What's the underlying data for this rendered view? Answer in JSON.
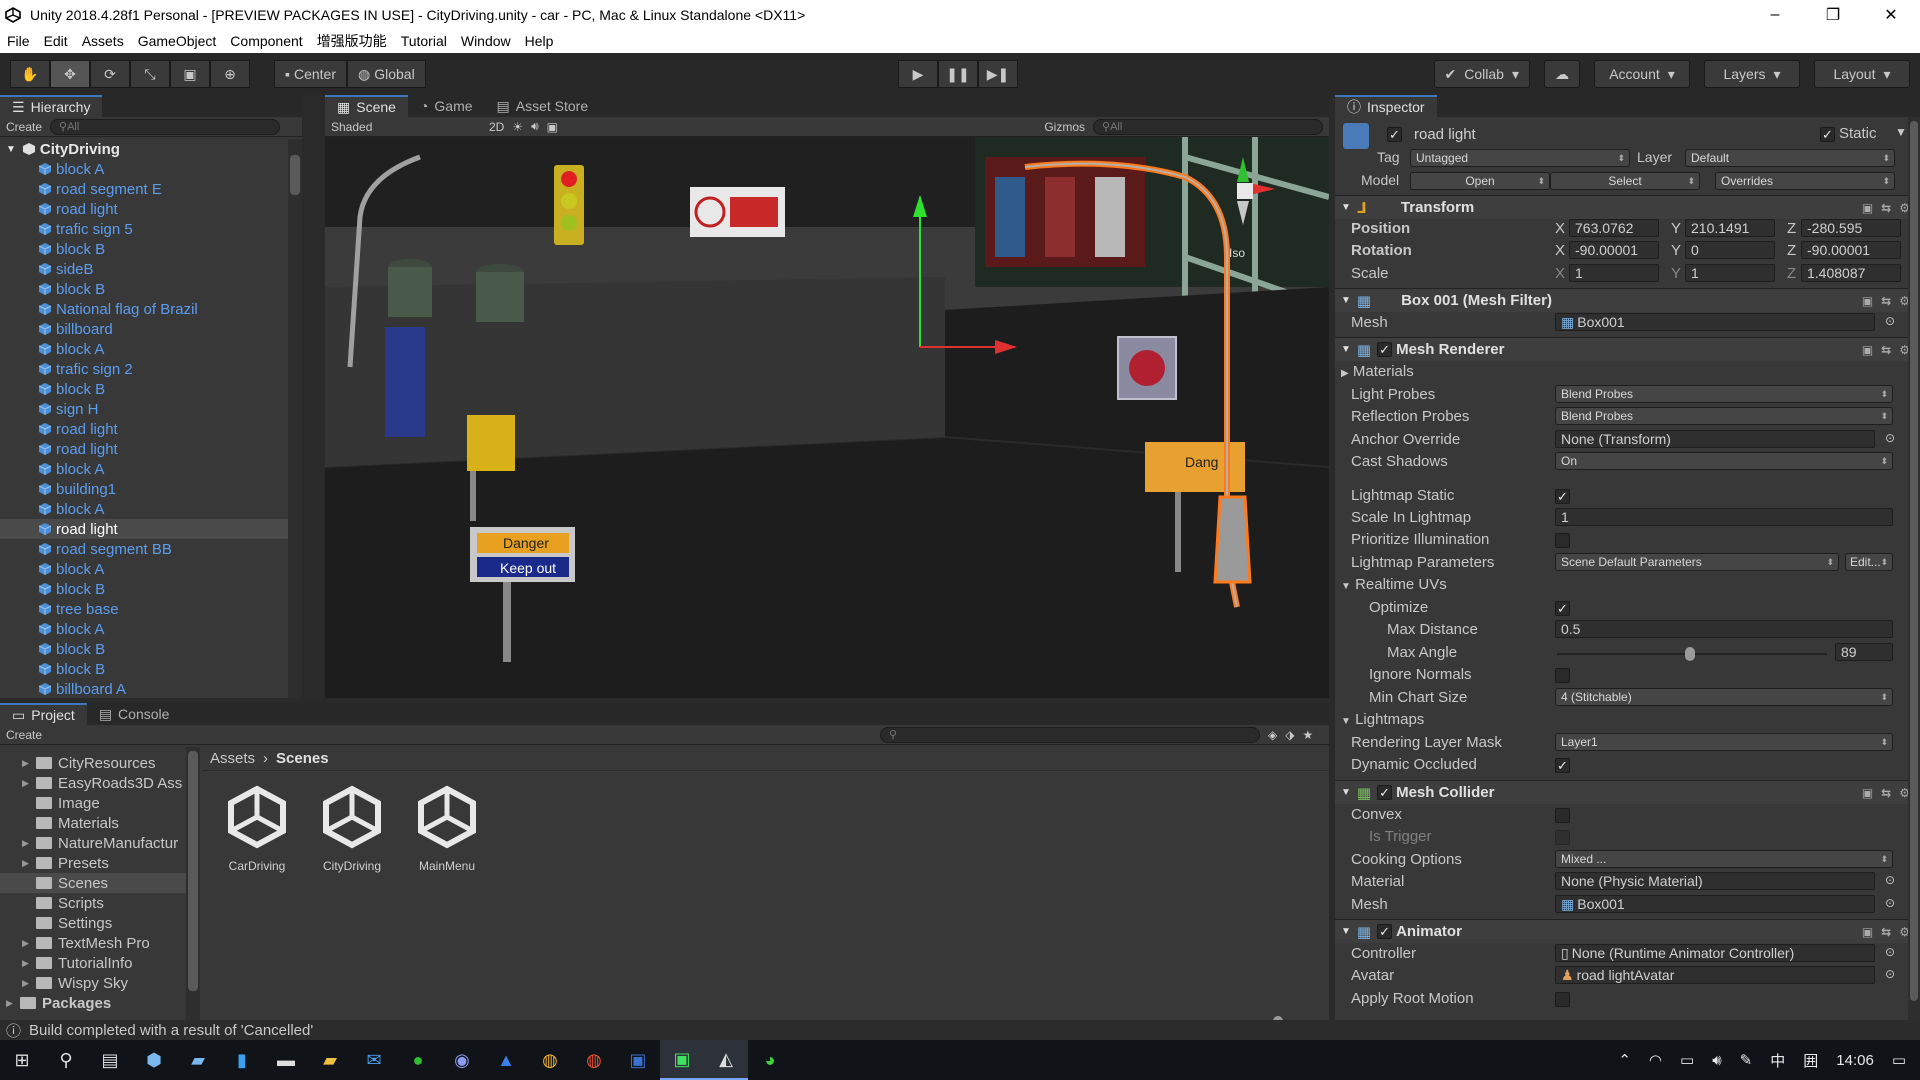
{
  "window": {
    "title": "Unity 2018.4.28f1 Personal - [PREVIEW PACKAGES IN USE] - CityDriving.unity - car - PC, Mac & Linux Standalone <DX11>",
    "controls": [
      "–",
      "❐",
      "✕"
    ]
  },
  "menu": [
    "File",
    "Edit",
    "Assets",
    "GameObject",
    "Component",
    "增强版功能",
    "Tutorial",
    "Window",
    "Help"
  ],
  "toolbar": {
    "pivot": "Center",
    "space": "Global",
    "collab": "Collab",
    "account": "Account",
    "layers": "Layers",
    "layout": "Layout"
  },
  "hierarchy": {
    "tab": "Hierarchy",
    "create": "Create",
    "search_placeholder": "All",
    "root": "CityDriving",
    "items": [
      "block A",
      "road segment E",
      "road light",
      "trafic sign 5",
      "block B",
      "sideB",
      "block B",
      "National flag of Brazil",
      "billboard",
      "block A",
      "trafic sign 2",
      "block B",
      "sign H",
      "road light",
      "road light",
      "block A",
      "building1",
      "block A",
      "road light",
      "road segment BB",
      "block A",
      "block B",
      "tree base",
      "block A",
      "block B",
      "block B",
      "billboard A"
    ],
    "selected_index": 18
  },
  "scene": {
    "tabs": [
      "Scene",
      "Game",
      "Asset Store"
    ],
    "shading": "Shaded",
    "mode_2d": "2D",
    "gizmos": "Gizmos",
    "search_placeholder": "All",
    "iso_label": "Iso",
    "sign_danger": "Danger",
    "sign_keep_out": "Keep out",
    "sign_danger2": "Dang"
  },
  "inspector": {
    "tab": "Inspector",
    "object_name": "road light",
    "static_label": "Static",
    "tag_label": "Tag",
    "tag_value": "Untagged",
    "layer_label": "Layer",
    "layer_value": "Default",
    "model_label": "Model",
    "model_open": "Open",
    "model_select": "Select",
    "model_overrides": "Overrides",
    "transform": {
      "title": "Transform",
      "position_label": "Position",
      "rotation_label": "Rotation",
      "scale_label": "Scale",
      "position": {
        "x": "763.0762",
        "y": "210.1491",
        "z": "-280.595"
      },
      "rotation": {
        "x": "-90.00001",
        "y": "0",
        "z": "-90.00001"
      },
      "scale": {
        "x": "1",
        "y": "1",
        "z": "1.408087"
      }
    },
    "mesh_filter": {
      "title": "Box 001 (Mesh Filter)",
      "mesh_label": "Mesh",
      "mesh_value": "Box001"
    },
    "mesh_renderer": {
      "title": "Mesh Renderer",
      "materials": "Materials",
      "light_probes_label": "Light Probes",
      "light_probes": "Blend Probes",
      "reflection_probes_label": "Reflection Probes",
      "reflection_probes": "Blend Probes",
      "anchor_override_label": "Anchor Override",
      "anchor_override": "None (Transform)",
      "cast_shadows_label": "Cast Shadows",
      "cast_shadows": "On",
      "lightmap_static_label": "Lightmap Static",
      "scale_in_lightmap_label": "Scale In Lightmap",
      "scale_in_lightmap": "1",
      "prioritize_label": "Prioritize Illumination",
      "lightmap_params_label": "Lightmap Parameters",
      "lightmap_params": "Scene Default Parameters",
      "edit": "Edit...",
      "realtime_uvs": "Realtime UVs",
      "optimize_label": "Optimize",
      "max_distance_label": "Max Distance",
      "max_distance": "0.5",
      "max_angle_label": "Max Angle",
      "max_angle": "89",
      "ignore_normals_label": "Ignore Normals",
      "min_chart_label": "Min Chart Size",
      "min_chart": "4 (Stitchable)",
      "lightmaps": "Lightmaps",
      "rendering_layer_label": "Rendering Layer Mask",
      "rendering_layer": "Layer1",
      "dynamic_occluded_label": "Dynamic Occluded"
    },
    "mesh_collider": {
      "title": "Mesh Collider",
      "convex_label": "Convex",
      "is_trigger_label": "Is Trigger",
      "cooking_label": "Cooking Options",
      "cooking": "Mixed ...",
      "material_label": "Material",
      "material": "None (Physic Material)",
      "mesh_label": "Mesh",
      "mesh": "Box001"
    },
    "animator": {
      "title": "Animator",
      "controller_label": "Controller",
      "controller": "None (Runtime Animator Controller)",
      "avatar_label": "Avatar",
      "avatar": "road lightAvatar",
      "root_motion_label": "Apply Root Motion"
    }
  },
  "project": {
    "tabs": [
      "Project",
      "Console"
    ],
    "create": "Create",
    "folders": [
      "CityResources",
      "EasyRoads3D Ass",
      "Image",
      "Materials",
      "NatureManufactur",
      "Presets",
      "Scenes",
      "Scripts",
      "Settings",
      "TextMesh Pro",
      "TutorialInfo",
      "Wispy Sky"
    ],
    "packages": "Packages",
    "breadcrumb": [
      "Assets",
      "Scenes"
    ],
    "assets": [
      "CarDriving",
      "CityDriving",
      "MainMenu"
    ]
  },
  "status": {
    "message": "Build completed with a result of 'Cancelled'"
  },
  "taskbar": {
    "time": "14:06",
    "ime": "中"
  }
}
